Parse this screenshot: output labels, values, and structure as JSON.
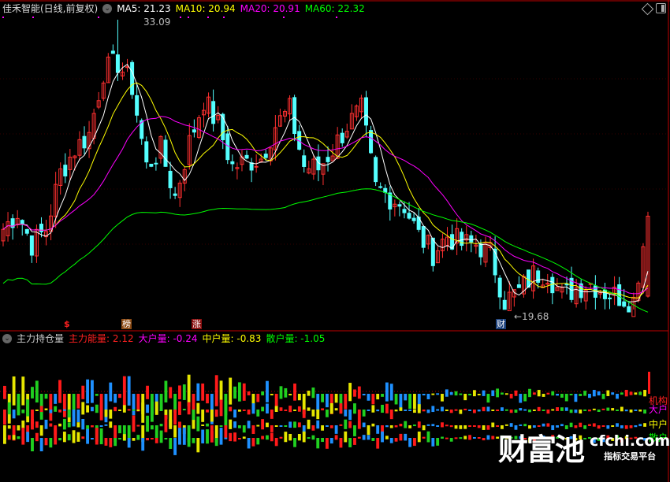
{
  "header": {
    "stock_name": "佳禾智能(日线,前复权)",
    "ma": [
      {
        "label": "MA5: 21.23",
        "color": "#ffffff"
      },
      {
        "label": "MA10: 20.94",
        "color": "#ffff00"
      },
      {
        "label": "MA20: 20.91",
        "color": "#ff00ff"
      },
      {
        "label": "MA60: 22.32",
        "color": "#00ff00"
      }
    ]
  },
  "annotations": {
    "high_label": "33.09",
    "low_label": "←19.68",
    "markers": [
      {
        "text": "$",
        "color": "#ff2020",
        "bg": "transparent"
      },
      {
        "text": "榜",
        "color": "#ffffff",
        "bg": "#8b4a14"
      },
      {
        "text": "涨",
        "color": "#ffffff",
        "bg": "#8b1010"
      },
      {
        "text": "财",
        "color": "#ffffff",
        "bg": "#1a3f7a"
      }
    ]
  },
  "indicator": {
    "title": "主力持仓量",
    "values": [
      {
        "label": "主力能量: 2.12",
        "color": "#ff2020"
      },
      {
        "label": "大户量: -0.24",
        "color": "#ff00ff"
      },
      {
        "label": "中户量: -0.83",
        "color": "#ffff00"
      },
      {
        "label": "散户量: -1.05",
        "color": "#00ff00"
      }
    ],
    "right_labels": [
      {
        "text": "机构",
        "color": "#ff2020"
      },
      {
        "text": "大户",
        "color": "#ff00ff"
      },
      {
        "text": "中户",
        "color": "#ffff00"
      },
      {
        "text": "散户",
        "color": "#00ff00"
      }
    ]
  },
  "watermark": {
    "brand": "财富池",
    "url": "cfchi.com",
    "tagline": "指标交易平台"
  },
  "colors": {
    "up": "#ff3030",
    "down": "#54ffff",
    "border": "#c00000"
  },
  "chart_data": {
    "type": "candlestick",
    "y_range": [
      19.68,
      33.09
    ],
    "key_closes": [
      23.4,
      24.2,
      22.7,
      23.4,
      26.0,
      27.1,
      27.8,
      30.7,
      31.1,
      30.0,
      26.3,
      27.1,
      24.9,
      27.4,
      29.4,
      28.2,
      26.3,
      26.5,
      26.7,
      28.2,
      28.9,
      26.3,
      26.2,
      27.1,
      28.2,
      28.9,
      25.3,
      24.9,
      24.5,
      23.1,
      22.3,
      23.1,
      22.7,
      22.7,
      22.3,
      20.1,
      20.5,
      21.3,
      21.4,
      20.3,
      20.7,
      20.9,
      20.5,
      20.3,
      20.1,
      24.0
    ],
    "candles_between_keys": 3
  }
}
